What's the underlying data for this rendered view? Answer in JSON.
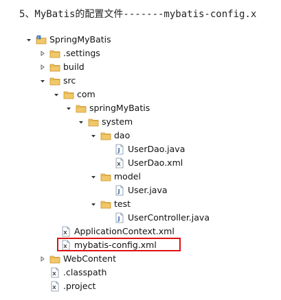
{
  "heading": "5、MyBatis的配置文件-------mybatis-config.x",
  "tree": {
    "project": "SpringMyBatis",
    "settings": ".settings",
    "build": "build",
    "src": "src",
    "com": "com",
    "springMyBatis": "springMyBatis",
    "system": "system",
    "dao": "dao",
    "userDaoJava": "UserDao.java",
    "userDaoXml": "UserDao.xml",
    "model": "model",
    "userJava": "User.java",
    "test": "test",
    "userControllerJava": "UserController.java",
    "applicationContextXml": "ApplicationContext.xml",
    "mybatisConfigXml": "mybatis-config.xml",
    "webContent": "WebContent",
    "classpath": ".classpath",
    "project_file": ".project"
  },
  "colors": {
    "highlight_border": "#e01010",
    "folder": "#e7b64a",
    "java_file": "#3a6ea5",
    "xml_file": "#5a5a5a"
  },
  "icons": {
    "expanded": "expanded-arrow-icon",
    "collapsed": "collapsed-arrow-icon",
    "folder": "folder-icon",
    "project": "java-project-icon",
    "java": "java-file-icon",
    "xml": "xml-file-icon"
  }
}
